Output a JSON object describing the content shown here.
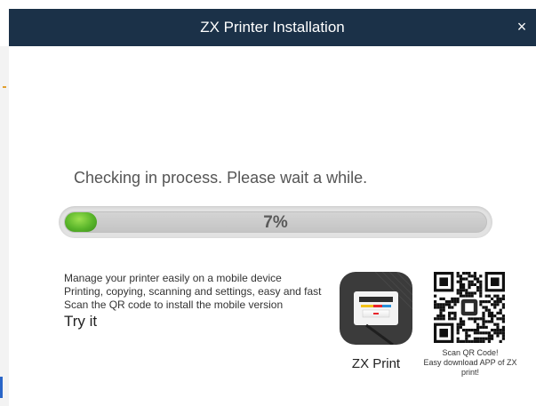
{
  "window": {
    "title": "ZX Printer Installation",
    "close_glyph": "×"
  },
  "status": {
    "message": "Checking in process. Please wait a while."
  },
  "progress": {
    "percent": 7,
    "label": "7%"
  },
  "promo": {
    "line1": "Manage your printer easily on a mobile device",
    "line2": "Printing, copying, scanning and settings, easy and fast",
    "line3": "Scan the QR code to install the mobile version",
    "try_label": "Try it"
  },
  "app": {
    "name": "ZX Print",
    "icon": "printer-app-icon"
  },
  "qr": {
    "caption_line1": "Scan QR Code!",
    "caption_line2": "Easy download APP of ZX",
    "caption_line3": "print!",
    "icon": "qr-code-icon"
  },
  "colors": {
    "titlebar": "#1b3148",
    "progress_fill": "#59b52a",
    "progress_track": "#c8c8c8"
  }
}
